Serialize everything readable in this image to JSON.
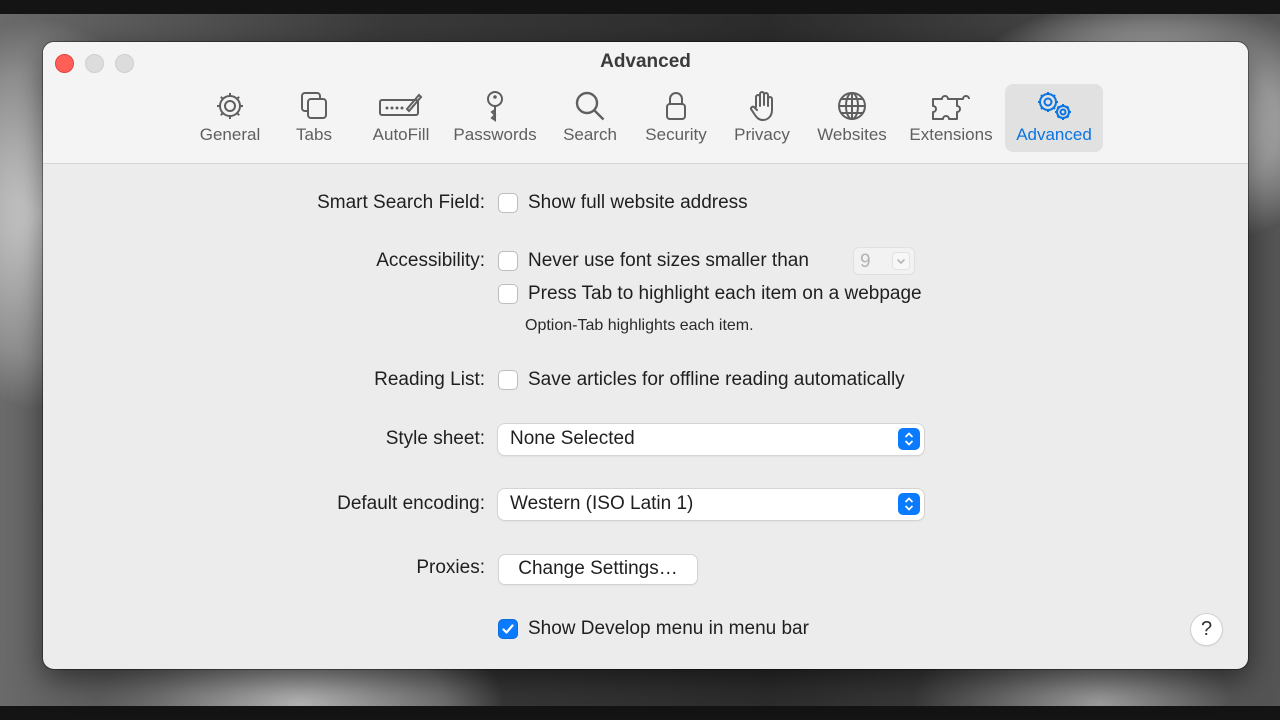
{
  "window": {
    "title": "Advanced"
  },
  "tabs": [
    {
      "label": "General",
      "icon": "gear-icon"
    },
    {
      "label": "Tabs",
      "icon": "tabs-icon"
    },
    {
      "label": "AutoFill",
      "icon": "autofill-icon"
    },
    {
      "label": "Passwords",
      "icon": "key-icon"
    },
    {
      "label": "Search",
      "icon": "search-icon"
    },
    {
      "label": "Security",
      "icon": "lock-icon"
    },
    {
      "label": "Privacy",
      "icon": "hand-icon"
    },
    {
      "label": "Websites",
      "icon": "globe-icon"
    },
    {
      "label": "Extensions",
      "icon": "puzzle-icon"
    },
    {
      "label": "Advanced",
      "icon": "gears-icon",
      "active": true
    }
  ],
  "settings": {
    "smart_search": {
      "label": "Smart Search Field:",
      "option": "Show full website address",
      "checked": false
    },
    "accessibility": {
      "label": "Accessibility:",
      "font_option": "Never use font sizes smaller than",
      "font_checked": false,
      "font_size": "9",
      "tab_option": "Press Tab to highlight each item on a webpage",
      "tab_checked": false,
      "hint": "Option-Tab highlights each item."
    },
    "reading_list": {
      "label": "Reading List:",
      "option": "Save articles for offline reading automatically",
      "checked": false
    },
    "style_sheet": {
      "label": "Style sheet:",
      "value": "None Selected"
    },
    "encoding": {
      "label": "Default encoding:",
      "value": "Western (ISO Latin 1)"
    },
    "proxies": {
      "label": "Proxies:",
      "button": "Change Settings…"
    },
    "develop": {
      "option": "Show Develop menu in menu bar",
      "checked": true
    }
  },
  "help": {
    "label": "?"
  },
  "colors": {
    "accent": "#0a7aff",
    "close": "#ff5f57",
    "active_tab_text": "#0a74e0"
  }
}
